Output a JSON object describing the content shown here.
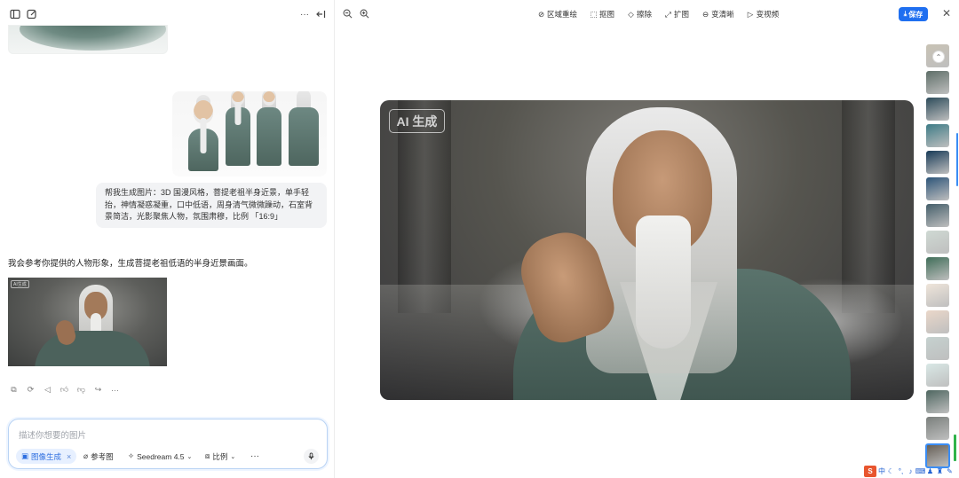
{
  "left": {
    "user_prompt": "帮我生成图片：3D 国漫风格，菩提老祖半身近景，单手轻抬，神情凝惑凝重，口中低语，周身清气微微躁动，石室背景简洁，光影聚焦人物，氛围肃穆，比例 「16:9」",
    "assistant_reply": "我会参考你提供的人物形象，生成菩提老祖低语的半身近景画面。",
    "thumb_badge": "AI生成",
    "input": {
      "placeholder": "描述你想要的图片",
      "mode_chip": "图像生成",
      "reference_label": "参考图",
      "model_label": "Seedream 4.5",
      "ratio_label": "比例",
      "more_label": "···"
    },
    "more_dots": "···"
  },
  "right": {
    "tools": [
      {
        "label": "区域重绘",
        "icon": "brush-icon"
      },
      {
        "label": "抠图",
        "icon": "cutout-icon"
      },
      {
        "label": "擦除",
        "icon": "eraser-icon"
      },
      {
        "label": "扩图",
        "icon": "expand-icon"
      },
      {
        "label": "变清晰",
        "icon": "enhance-icon"
      },
      {
        "label": "变视频",
        "icon": "video-icon"
      }
    ],
    "save_label": "保存",
    "ai_badge": "AI 生成",
    "thumb_colors": [
      "#c8c2b4",
      "#5e6e68",
      "#2c4b5a",
      "#3d7b86",
      "#173a57",
      "#2c5478",
      "#445e6a",
      "#cfd9d3",
      "#3f6d58",
      "#efe5da",
      "#ead7c9",
      "#c5d1cf",
      "#d9e8e6",
      "#4e6660",
      "#7a7f7c",
      "#676057"
    ]
  },
  "ime": {
    "lang": "中"
  }
}
